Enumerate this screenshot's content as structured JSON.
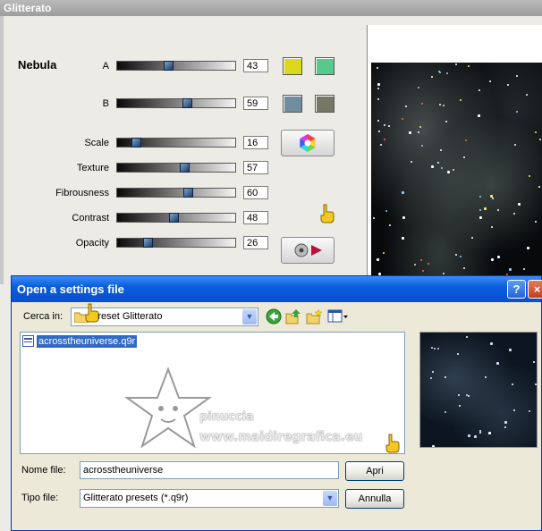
{
  "window": {
    "title": "Glitterato"
  },
  "panel": {
    "section_label": "Nebula",
    "params": [
      {
        "label": "A",
        "value": "43",
        "fraction": 0.43
      },
      {
        "label": "B",
        "value": "59",
        "fraction": 0.59
      },
      {
        "label": "Scale",
        "value": "16",
        "fraction": 0.16
      },
      {
        "label": "Texture",
        "value": "57",
        "fraction": 0.57
      },
      {
        "label": "Fibrousness",
        "value": "60",
        "fraction": 0.6
      },
      {
        "label": "Contrast",
        "value": "48",
        "fraction": 0.48
      },
      {
        "label": "Opacity",
        "value": "26",
        "fraction": 0.26
      }
    ],
    "swatches": {
      "a1": "#dcd81e",
      "a2": "#58c98a",
      "b1": "#6f8fa0",
      "b2": "#777766"
    }
  },
  "dialog": {
    "title": "Open a settings file",
    "help": "?",
    "close": "×",
    "look_in_label": "Cerca in:",
    "look_in_value": "Preset Glitterato",
    "file_name": "acrosstheuniverse.q9r",
    "file_name_label": "Nome file:",
    "file_name_value": "acrosstheuniverse",
    "file_type_label": "Tipo file:",
    "file_type_value": "Glitterato presets (*.q9r)",
    "open_button": "Apri",
    "cancel_button": "Annulla"
  },
  "watermark": {
    "name": "pinuccia",
    "site": "www.maidiregrafica.eu"
  }
}
